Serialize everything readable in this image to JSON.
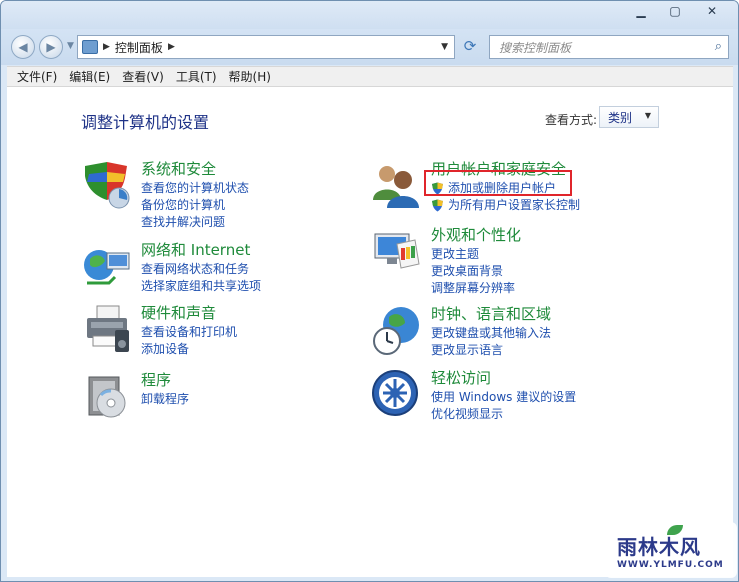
{
  "window": {
    "caption": {
      "minimize": "▁",
      "restore": "▢",
      "close": "✕"
    }
  },
  "nav": {
    "back_glyph": "◀",
    "forward_glyph": "▶",
    "dropdown_glyph": "▼",
    "address_segment_sep": "▶",
    "address_current": "控制面板",
    "address_trailing_sep": "▶",
    "address_dropdown": "▼",
    "refresh_glyph": "⟳",
    "search_placeholder": "搜索控制面板",
    "search_glyph": "⌕"
  },
  "menubar": {
    "items": [
      "文件(F)",
      "编辑(E)",
      "查看(V)",
      "工具(T)",
      "帮助(H)"
    ]
  },
  "main": {
    "title": "调整计算机的设置",
    "view_by_label": "查看方式:",
    "view_by_value": "类别",
    "view_by_drop": "▼"
  },
  "categories": [
    {
      "title": "系统和安全",
      "icon": "system-security-icon",
      "links": [
        "查看您的计算机状态",
        "备份您的计算机",
        "查找并解决问题"
      ]
    },
    {
      "title": "网络和 Internet",
      "icon": "network-internet-icon",
      "links": [
        "查看网络状态和任务",
        "选择家庭组和共享选项"
      ]
    },
    {
      "title": "硬件和声音",
      "icon": "hardware-sound-icon",
      "links": [
        "查看设备和打印机",
        "添加设备"
      ]
    },
    {
      "title": "程序",
      "icon": "programs-icon",
      "links": [
        "卸载程序"
      ]
    },
    {
      "title": "用户帐户和家庭安全",
      "icon": "user-accounts-icon",
      "links": [
        "添加或删除用户帐户",
        "为所有用户设置家长控制"
      ]
    },
    {
      "title": "外观和个性化",
      "icon": "appearance-icon",
      "links": [
        "更改主题",
        "更改桌面背景",
        "调整屏幕分辨率"
      ]
    },
    {
      "title": "时钟、语言和区域",
      "icon": "clock-language-icon",
      "links": [
        "更改键盘或其他输入法",
        "更改显示语言"
      ]
    },
    {
      "title": "轻松访问",
      "icon": "ease-of-access-icon",
      "links": [
        "使用 Windows 建议的设置",
        "优化视频显示"
      ]
    }
  ],
  "watermark": {
    "main": "雨林木风",
    "url": "WWW.YLMFU.COM"
  },
  "colors": {
    "link": "#1f4fae",
    "category_title": "#1e8a3a",
    "highlight": "#e0252b"
  }
}
